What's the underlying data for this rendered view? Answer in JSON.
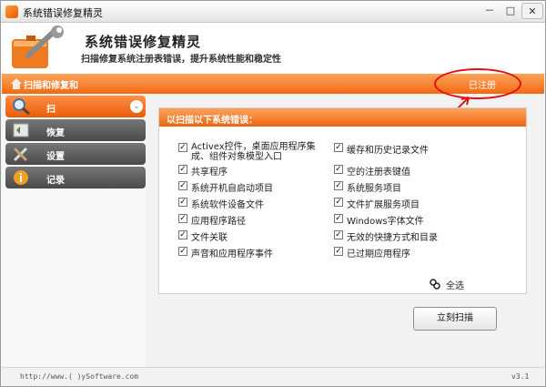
{
  "window": {
    "title": "系统错误修复精灵",
    "min": "－",
    "max": "□",
    "close": "✕"
  },
  "header": {
    "title": "系统错误修复精灵",
    "subtitle": "扫描修复系统注册表错误，提升系统性能和稳定性"
  },
  "navbar": {
    "breadcrumb": "扫描和修复和",
    "registered": "已注册"
  },
  "sidebar": {
    "items": [
      {
        "label": "扫",
        "icon": "magnifier-icon",
        "active": true
      },
      {
        "label": "恢复",
        "icon": "restore-icon",
        "active": false
      },
      {
        "label": "设置",
        "icon": "tools-icon",
        "active": false
      },
      {
        "label": "记录",
        "icon": "info-icon",
        "active": false
      }
    ]
  },
  "panel": {
    "heading": "以扫描以下系统错误：",
    "left_checks": [
      {
        "label": "Activex控件，桌面应用程序集成、组件对象模型入口",
        "checked": true
      },
      {
        "label": "共享程序",
        "checked": true
      },
      {
        "label": "系统开机自启动项目",
        "checked": true
      },
      {
        "label": "系统软件设备文件",
        "checked": true
      },
      {
        "label": "应用程序路径",
        "checked": true
      },
      {
        "label": "文件关联",
        "checked": true
      },
      {
        "label": "声音和应用程序事件",
        "checked": true
      }
    ],
    "right_checks": [
      {
        "label": "缓存和历史记录文件",
        "checked": true
      },
      {
        "label": "空的注册表键值",
        "checked": true
      },
      {
        "label": "系统服务项目",
        "checked": true
      },
      {
        "label": "文件扩展服务项目",
        "checked": true
      },
      {
        "label": "Windows字体文件",
        "checked": true
      },
      {
        "label": "无效的快捷方式和目录",
        "checked": true
      },
      {
        "label": "已过期应用程序",
        "checked": true
      }
    ],
    "select_all": "全选",
    "scan_button": "立刻扫描"
  },
  "footer": {
    "url": "http://www.(  )ySoftware.com",
    "version": "v3.1"
  },
  "colors": {
    "accent": "#f26a12",
    "sidebar_dark": "#555555",
    "annotation": "#e01010"
  }
}
